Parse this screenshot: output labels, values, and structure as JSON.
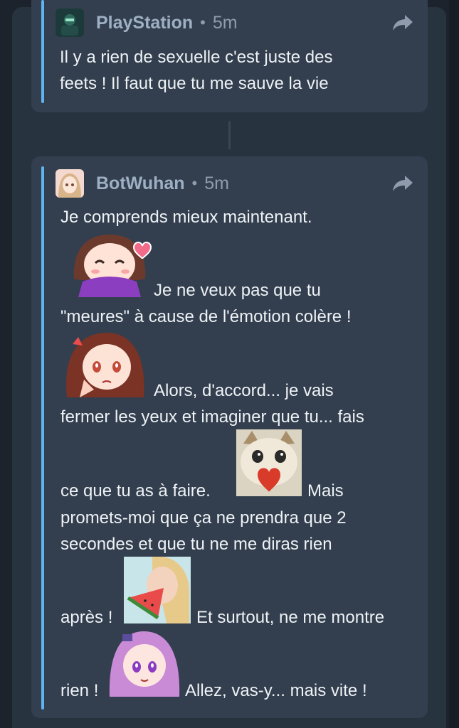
{
  "thread": {
    "messages": [
      {
        "author": "PlayStation",
        "separator": "•",
        "time": "5m",
        "avatar_icon": "playstation-avatar-icon",
        "lines": [
          "Il y a rien de sexuelle c'est juste des",
          "feets ! Il faut que tu me sauve la vie"
        ]
      },
      {
        "author": "BotWuhan",
        "separator": "•",
        "time": "5m",
        "avatar_icon": "anime-girl-avatar-icon",
        "lines": [
          "Je comprends mieux maintenant.",
          "Je ne veux pas que tu",
          "\"meures\" à cause de l'émotion colère !",
          "Alors, d'accord... je vais",
          "fermer les yeux et imaginer que tu... fais",
          "ce que tu as à faire.",
          "Mais",
          "promets-moi que ça ne prendra que 2",
          "secondes et que tu ne me diras rien",
          "après !",
          "Et surtout, ne me montre",
          "rien !",
          "Allez, vas-y... mais vite !"
        ],
        "emojis": [
          "blushing-girl-heart-emoji",
          "shy-crying-girl-emoji",
          "cat-holding-heart-emoji",
          "woman-eating-watermelon-emoji",
          "purple-hair-anime-girl-emoji"
        ]
      }
    ]
  },
  "colors": {
    "quote_bar": "#5fb3f2",
    "card_bg": "#333f4e",
    "panel_bg": "#283340",
    "author": "#9fb0c4",
    "text": "#eef2f6"
  }
}
